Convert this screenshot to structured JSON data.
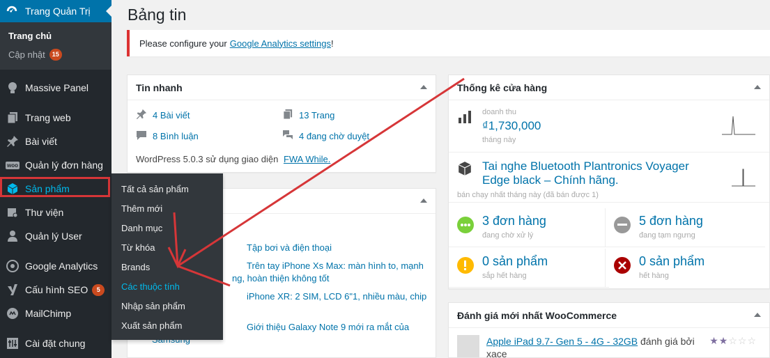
{
  "sidebar": {
    "dashboard_label": "Trang Quản Trị",
    "sub_home": "Trang chủ",
    "sub_updates": "Cập nhật",
    "updates_count": "15",
    "items": [
      {
        "label": "Massive Panel"
      },
      {
        "label": "Trang web"
      },
      {
        "label": "Bài viết"
      },
      {
        "label": "Quản lý đơn hàng"
      },
      {
        "label": "Sản phẩm"
      },
      {
        "label": "Thư viện"
      },
      {
        "label": "Quản lý User"
      },
      {
        "label": "Google Analytics"
      },
      {
        "label": "Cấu hình SEO",
        "badge": "5"
      },
      {
        "label": "MailChimp"
      },
      {
        "label": "Cài đặt chung"
      }
    ],
    "woo_icon_text": "woo"
  },
  "flyout": {
    "items": [
      {
        "label": "Tất cả sản phẩm"
      },
      {
        "label": "Thêm mới"
      },
      {
        "label": "Danh mục"
      },
      {
        "label": "Từ khóa"
      },
      {
        "label": "Brands"
      },
      {
        "label": "Các thuộc tính"
      },
      {
        "label": "Nhập sản phẩm"
      },
      {
        "label": "Xuất sản phẩm"
      }
    ]
  },
  "main": {
    "title": "Bảng tin",
    "notice_text": "Please configure your",
    "notice_link": "Google Analytics settings",
    "notice_end": "!"
  },
  "glance": {
    "title": "Tin nhanh",
    "posts": "4 Bài viết",
    "pages": "13 Trang",
    "comments": "8 Bình luận",
    "pending": "4 đang chờ duyệt",
    "wp_text": "WordPress 5.0.3 sử dụng giao diện",
    "theme": "FWA While."
  },
  "activity": {
    "links": [
      "Tập bơi và điện thoại",
      "Trên tay iPhone Xs Max: màn hình to, mạnh",
      "ng, hoàn thiện không tốt",
      "iPhone XR: 2 SIM, LCD 6\"1, nhiều màu, chip",
      "Giới thiệu Galaxy Note 9 mới ra mắt của",
      "Samsung"
    ]
  },
  "store": {
    "title": "Thống kê cửa hàng",
    "revenue_label": "doanh thu",
    "revenue_value": "₫1,730,000",
    "revenue_period": "tháng này",
    "top_product": "Tai nghe Bluetooth Plantronics Voyager Edge black – Chính hãng.",
    "top_product_sub": "bán chạy nhất tháng này (đã bán được 1)",
    "cells": [
      {
        "big": "3 đơn hàng",
        "small": "đang chờ xử lý",
        "color": "#7ad03a"
      },
      {
        "big": "5 đơn hàng",
        "small": "đang tạm ngưng",
        "color": "#999999"
      },
      {
        "big": "0 sản phẩm",
        "small": "sắp hết hàng",
        "color": "#ffba00"
      },
      {
        "big": "0 sản phẩm",
        "small": "hết hàng",
        "color": "#a00000"
      }
    ]
  },
  "reviews": {
    "title": "Đánh giá mới nhất WooCommerce",
    "product": "Apple iPad 9.7- Gen 5 - 4G - 32GB",
    "suffix": "đánh giá bởi",
    "author": "xace",
    "rating": 2
  },
  "colors": {
    "accent": "#0073aa",
    "sidebar_bg": "#23282d",
    "annotation_red": "#d63638"
  }
}
